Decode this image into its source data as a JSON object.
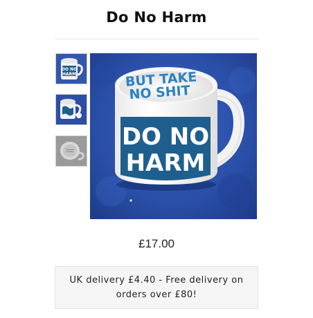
{
  "product": {
    "title": "Do No Harm",
    "price": "£17.00",
    "delivery_line1": "UK delivery £4.40 - Free delivery on",
    "delivery_line2": "orders over £80!"
  },
  "image": {
    "mug_front_text": [
      "DO NO",
      "HARM"
    ],
    "mug_inside_text": [
      "BUT TAKE",
      "NO SHIT"
    ]
  },
  "colors": {
    "mug_blue": "#1e5f8e",
    "background_blue": "#2a4fa8",
    "divider": "#e3e3e3",
    "delivery_box_bg": "#f5f5f5"
  }
}
